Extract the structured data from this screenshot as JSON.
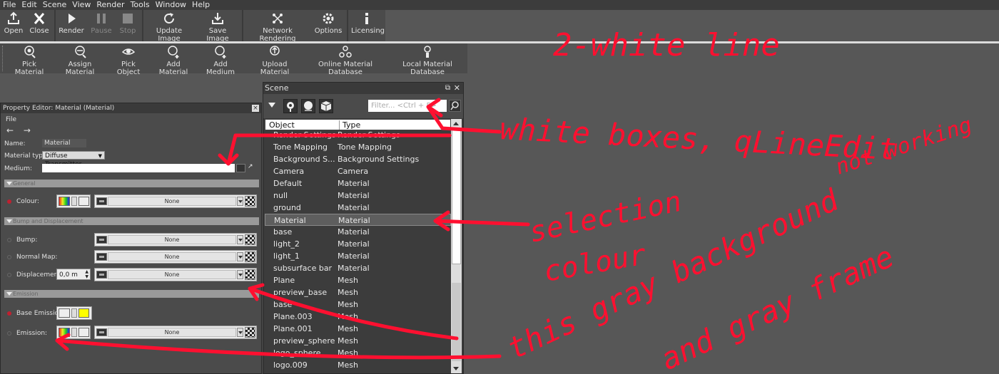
{
  "menu": [
    "File",
    "Edit",
    "Scene",
    "View",
    "Render",
    "Tools",
    "Window",
    "Help"
  ],
  "toolbar1": [
    {
      "label": "Open",
      "icon": "upload-icon"
    },
    {
      "label": "Close",
      "icon": "close-icon"
    },
    {
      "label": "Render",
      "icon": "play-icon"
    },
    {
      "label": "Pause",
      "icon": "pause-icon"
    },
    {
      "label": "Stop",
      "icon": "stop-icon"
    },
    {
      "label": "Update Image",
      "icon": "refresh-icon"
    },
    {
      "label": "Save Image",
      "icon": "download-icon"
    },
    {
      "label": "Network Rendering",
      "icon": "network-icon"
    },
    {
      "label": "Options",
      "icon": "gear-icon"
    },
    {
      "label": "Licensing",
      "icon": "info-icon"
    }
  ],
  "toolbar2": [
    {
      "label": "Pick Material",
      "icon": "pick-material-icon"
    },
    {
      "label": "Assign Material",
      "icon": "assign-material-icon"
    },
    {
      "label": "Pick Object",
      "icon": "eye-icon"
    },
    {
      "label": "Add Material",
      "icon": "add-material-icon"
    },
    {
      "label": "Add Medium",
      "icon": "add-medium-icon"
    },
    {
      "label": "Upload Material",
      "icon": "upload-material-icon"
    },
    {
      "label": "Online Material Database",
      "icon": "online-database-icon"
    },
    {
      "label": "Local Material Database",
      "icon": "local-database-icon"
    }
  ],
  "property_editor": {
    "title": "Property Editor: Material (Material)",
    "menu": "File",
    "name_label": "Name:",
    "name_value": "Material",
    "type_label": "Material type:",
    "type_value": "Diffuse Transmitter",
    "medium_label": "Medium:",
    "sections": {
      "general": "General",
      "bump": "Bump and Displacement",
      "emission": "Emission"
    },
    "colour_label": "Colour:",
    "bump_label": "Bump:",
    "normal_label": "Normal Map:",
    "displacement_label": "Displacement:",
    "displacement_value": "0,0 m",
    "base_emission_label": "Base Emission:",
    "emission_label": "Emission:",
    "none": "None",
    "emission_color": "#ffff00"
  },
  "scene": {
    "title": "Scene",
    "filter_placeholder": "Filter... <Ctrl + F>",
    "col_object": "Object",
    "col_type": "Type",
    "rows": [
      {
        "object": "Render Settings",
        "type": "Render Settings"
      },
      {
        "object": "Tone Mapping",
        "type": "Tone Mapping"
      },
      {
        "object": "Background S...",
        "type": "Background Settings"
      },
      {
        "object": "Camera",
        "type": "Camera"
      },
      {
        "object": "Default",
        "type": "Material"
      },
      {
        "object": "null",
        "type": "Material"
      },
      {
        "object": "ground",
        "type": "Material"
      },
      {
        "object": "Material",
        "type": "Material"
      },
      {
        "object": "base",
        "type": "Material"
      },
      {
        "object": "light_2",
        "type": "Material"
      },
      {
        "object": "light_1",
        "type": "Material"
      },
      {
        "object": "subsurface bar",
        "type": "Material"
      },
      {
        "object": "Plane",
        "type": "Mesh"
      },
      {
        "object": "preview_base",
        "type": "Mesh"
      },
      {
        "object": "base",
        "type": "Mesh"
      },
      {
        "object": "Plane.003",
        "type": "Mesh"
      },
      {
        "object": "Plane.001",
        "type": "Mesh"
      },
      {
        "object": "preview_sphere",
        "type": "Mesh"
      },
      {
        "object": "logo_sphere",
        "type": "Mesh"
      },
      {
        "object": "logo.009",
        "type": "Mesh"
      }
    ],
    "selected_index": 7
  },
  "annotations": {
    "a1": "2-white line",
    "a2": "white boxes, qLineEdit",
    "a3": "not working",
    "a4": "selection",
    "a5": "colour",
    "a6": "this gray background",
    "a7": "and gray frame",
    "color": "#ff1030"
  }
}
